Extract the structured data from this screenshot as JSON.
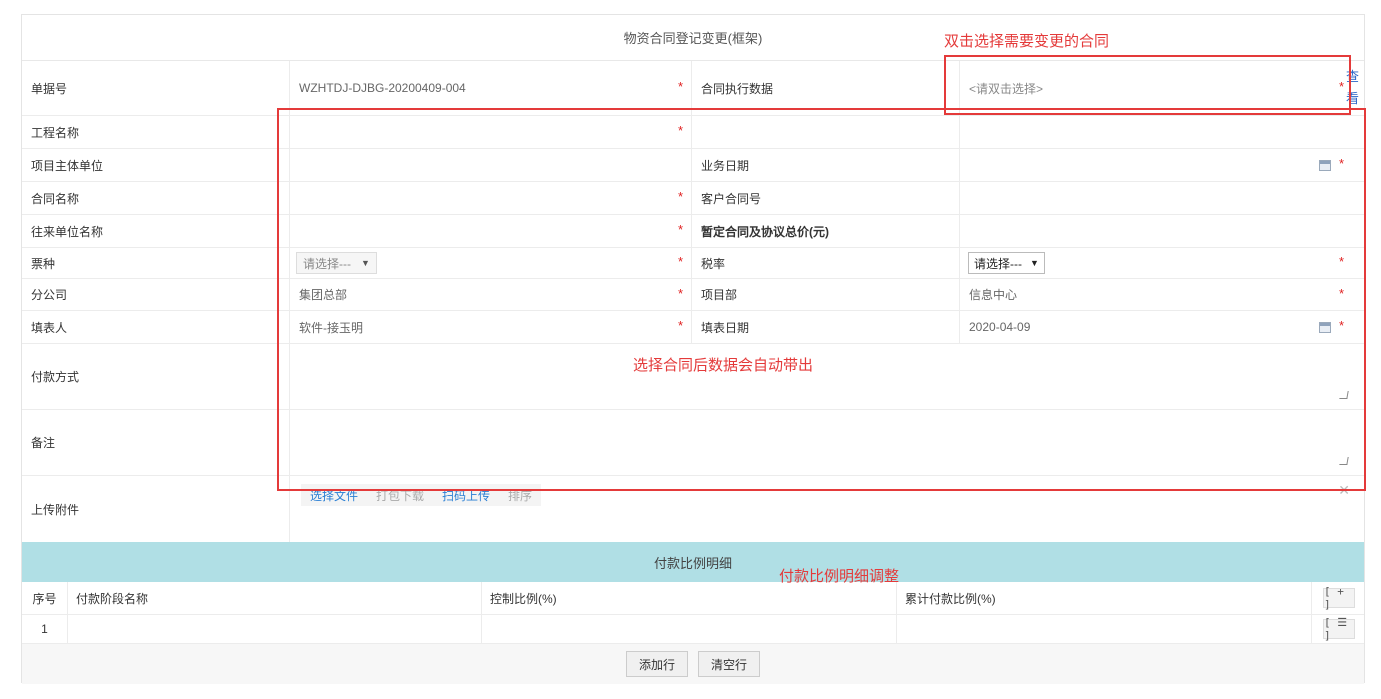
{
  "form": {
    "title": "物资合同登记变更(框架)",
    "rows": {
      "bill_no": {
        "label": "单据号",
        "value": "WZHTDJ-DJBG-20200409-004",
        "right_label": "合同执行数据",
        "right_placeholder": "<请双击选择>"
      },
      "project": {
        "label": "工程名称"
      },
      "owner_unit": {
        "label": "项目主体单位",
        "right_label": "业务日期"
      },
      "contract_name": {
        "label": "合同名称",
        "right_label": "客户合同号"
      },
      "partner": {
        "label": "往来单位名称",
        "right_label": "暂定合同及协议总价(元)"
      },
      "ticket_type": {
        "label": "票种",
        "select_value": "请选择---",
        "right_label": "税率",
        "right_select_value": "请选择---"
      },
      "branch": {
        "label": "分公司",
        "value": "集团总部",
        "right_label": "项目部",
        "right_value": "信息中心"
      },
      "filler": {
        "label": "填表人",
        "value": "软件-接玉明",
        "right_label": "填表日期",
        "right_value": "2020-04-09"
      },
      "payment_method": {
        "label": "付款方式"
      },
      "remark": {
        "label": "备注"
      },
      "attachment": {
        "label": "上传附件",
        "buttons": [
          "选择文件",
          "打包下载",
          "扫码上传",
          "排序"
        ]
      }
    },
    "view_link": "查看"
  },
  "payment": {
    "section_title": "付款比例明细",
    "columns": [
      "序号",
      "付款阶段名称",
      "控制比例(%)",
      "累计付款比例(%)"
    ],
    "add_symbol": "[ + ]",
    "rows": [
      {
        "no": "1",
        "menu_symbol": "[ ☰ ]"
      }
    ],
    "add_row_label": "添加行",
    "clear_rows_label": "清空行"
  },
  "annotations": {
    "select_contract": "双击选择需要变更的合同",
    "auto_fill": "选择合同后数据会自动带出",
    "adjust_ratio": "付款比例明细调整",
    "color": "#e43a3a"
  },
  "colors": {
    "required": "#e02020",
    "link": "#2a7fd4",
    "section_bg": "#b0dfe5"
  },
  "icons": {
    "calendar": "calendar-icon",
    "dropdown": "caret-down-icon",
    "close": "close-icon"
  }
}
